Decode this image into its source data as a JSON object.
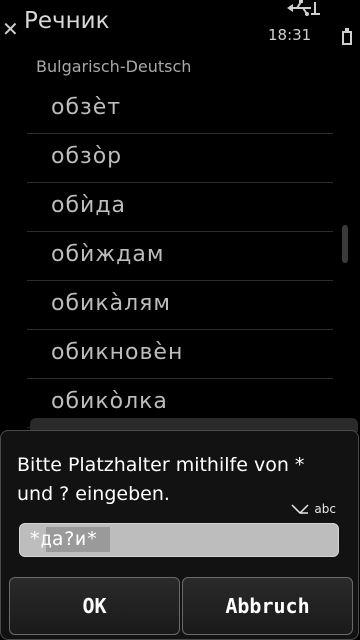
{
  "header": {
    "app_title": "Речник",
    "time": "18:31",
    "subtitle": "Bulgarisch-Deutsch"
  },
  "results": [
    "обзѐт",
    "обзо̀р",
    "обѝда",
    "обѝждам",
    "обика̀лям",
    "обикновѐн",
    "обико̀лка"
  ],
  "dialog": {
    "prompt": "Bitte Platzhalter mithilfe von * und ? eingeben.",
    "input_mode": "abc",
    "query_value": "*да?и*",
    "ok_label": "OK",
    "cancel_label": "Abbruch"
  }
}
